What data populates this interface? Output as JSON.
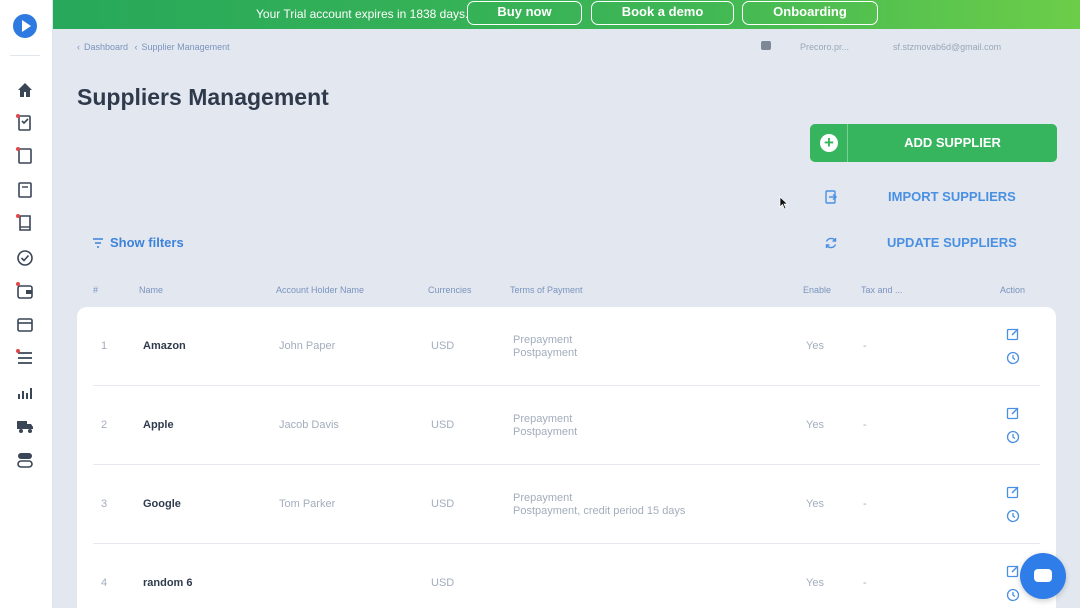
{
  "trial": {
    "message": "Your Trial account expires in 1838 days.",
    "buy_now": "Buy now",
    "book_demo": "Book a demo",
    "onboarding": "Onboarding"
  },
  "breadcrumb": {
    "dashboard": "Dashboard",
    "current": "Supplier Management"
  },
  "header_right": {
    "plan": "Precoro.pr...",
    "email": "sf.stzmovab6d@gmail.com"
  },
  "page": {
    "title": "Suppliers Management"
  },
  "actions": {
    "add_supplier": "ADD SUPPLIER",
    "import_suppliers": "IMPORT SUPPLIERS",
    "update_suppliers": "UPDATE SUPPLIERS",
    "show_filters": "Show filters"
  },
  "table": {
    "columns": {
      "num": "#",
      "name": "Name",
      "account_holder": "Account Holder Name",
      "currencies": "Currencies",
      "terms": "Terms of Payment",
      "enable": "Enable",
      "tax": "Tax and ...",
      "action": "Action"
    },
    "rows": [
      {
        "num": "1",
        "name": "Amazon",
        "holder": "John Paper",
        "currency": "USD",
        "pay1": "Prepayment",
        "pay2": "Postpayment",
        "enable": "Yes",
        "tax": "-"
      },
      {
        "num": "2",
        "name": "Apple",
        "holder": "Jacob Davis",
        "currency": "USD",
        "pay1": "Prepayment",
        "pay2": "Postpayment",
        "enable": "Yes",
        "tax": "-"
      },
      {
        "num": "3",
        "name": "Google",
        "holder": "Tom Parker",
        "currency": "USD",
        "pay1": "Prepayment",
        "pay2": "Postpayment, credit period 15 days",
        "enable": "Yes",
        "tax": "-"
      },
      {
        "num": "4",
        "name": "random 6",
        "holder": "",
        "currency": "USD",
        "pay1": "",
        "pay2": "",
        "enable": "Yes",
        "tax": "-"
      }
    ]
  },
  "colors": {
    "accent_green": "#36b45e",
    "link_blue": "#4a90e2",
    "background": "#e3e8f0"
  },
  "sidebar_icons": [
    "home-icon",
    "approval-list-icon",
    "document-icon",
    "invoice-icon",
    "receipt-icon",
    "check-circle-icon",
    "wallet-icon",
    "card-icon",
    "list-icon",
    "analytics-icon",
    "delivery-truck-icon",
    "settings-toggle-icon"
  ]
}
